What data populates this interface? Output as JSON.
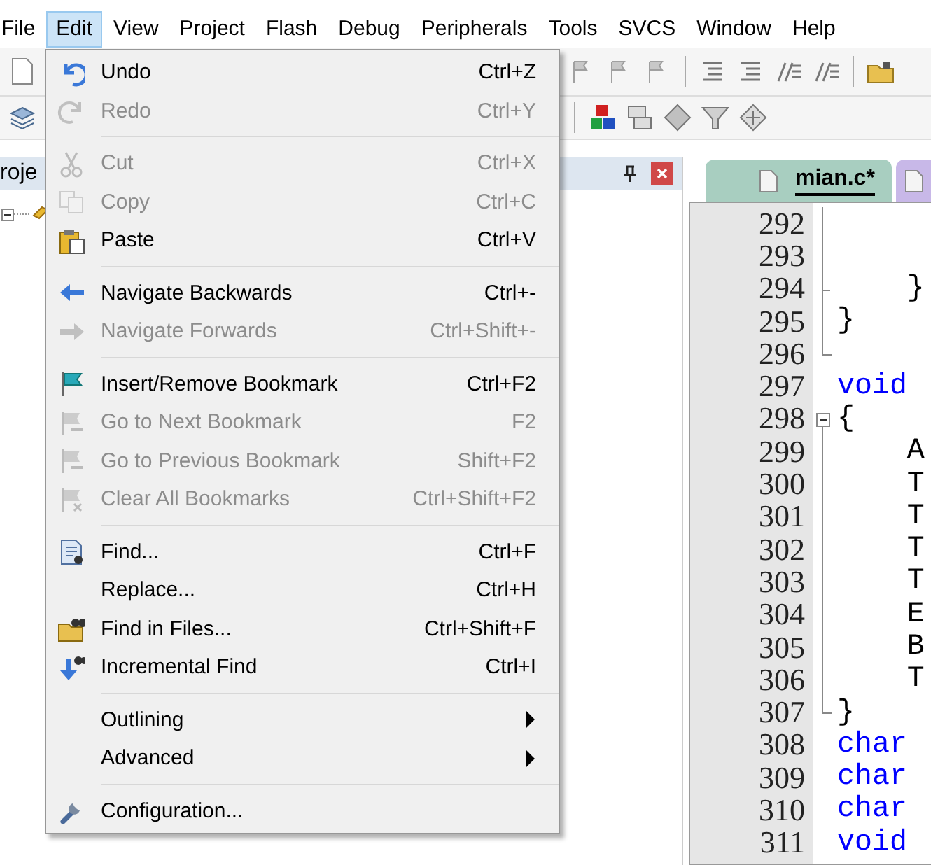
{
  "menubar": [
    {
      "label": "File",
      "selected": false
    },
    {
      "label": "Edit",
      "selected": true
    },
    {
      "label": "View",
      "selected": false
    },
    {
      "label": "Project",
      "selected": false
    },
    {
      "label": "Flash",
      "selected": false
    },
    {
      "label": "Debug",
      "selected": false
    },
    {
      "label": "Peripherals",
      "selected": false
    },
    {
      "label": "Tools",
      "selected": false
    },
    {
      "label": "SVCS",
      "selected": false
    },
    {
      "label": "Window",
      "selected": false
    },
    {
      "label": "Help",
      "selected": false
    }
  ],
  "project_panel": {
    "title": "roje"
  },
  "editor": {
    "tabs": [
      {
        "label": "mian.c*",
        "selected": true
      },
      {
        "selected": false
      }
    ],
    "lines": [
      {
        "number": "292",
        "fold_guide": true,
        "fold_box": false,
        "fold_end": false
      },
      {
        "number": "293",
        "fold_guide": true,
        "fold_box": false,
        "fold_end": false
      },
      {
        "number": "294",
        "code": "    }",
        "fold_guide": true,
        "fold_box": false,
        "fold_end": true
      },
      {
        "number": "295",
        "code": "}",
        "fold_guide": true,
        "fold_box": false,
        "fold_end": false
      },
      {
        "number": "296",
        "fold_guide": false,
        "fold_box": false,
        "fold_end": true
      },
      {
        "number": "297",
        "code": "void",
        "kind": "keyword",
        "fold_guide": false,
        "fold_box": false,
        "fold_end": false
      },
      {
        "number": "298",
        "code": "{",
        "fold_guide": false,
        "fold_box": true,
        "fold_end": false
      },
      {
        "number": "299",
        "code": "    A",
        "fold_guide": true,
        "fold_box": false,
        "fold_end": false
      },
      {
        "number": "300",
        "code": "    T",
        "fold_guide": true,
        "fold_box": false,
        "fold_end": false
      },
      {
        "number": "301",
        "code": "    T",
        "fold_guide": true,
        "fold_box": false,
        "fold_end": false
      },
      {
        "number": "302",
        "code": "    T",
        "fold_guide": true,
        "fold_box": false,
        "fold_end": false
      },
      {
        "number": "303",
        "code": "    T",
        "fold_guide": true,
        "fold_box": false,
        "fold_end": false
      },
      {
        "number": "304",
        "code": "    E",
        "fold_guide": true,
        "fold_box": false,
        "fold_end": false
      },
      {
        "number": "305",
        "code": "    B",
        "fold_guide": true,
        "fold_box": false,
        "fold_end": false
      },
      {
        "number": "306",
        "code": "    T",
        "fold_guide": true,
        "fold_box": false,
        "fold_end": false
      },
      {
        "number": "307",
        "code": "}",
        "fold_guide": false,
        "fold_box": false,
        "fold_end": true
      },
      {
        "number": "308",
        "code": "char",
        "kind": "keyword",
        "fold_guide": false,
        "fold_box": false,
        "fold_end": false
      },
      {
        "number": "309",
        "code": "char",
        "kind": "keyword",
        "fold_guide": false,
        "fold_box": false,
        "fold_end": false
      },
      {
        "number": "310",
        "code": "char",
        "kind": "keyword",
        "fold_guide": false,
        "fold_box": false,
        "fold_end": false
      },
      {
        "number": "311",
        "code": "void",
        "kind": "keyword",
        "fold_guide": false,
        "fold_box": false,
        "fold_end": false
      }
    ]
  },
  "edit_menu": [
    {
      "kind": "item",
      "label": "Undo",
      "shortcut": "Ctrl+Z",
      "disabled": false
    },
    {
      "kind": "item",
      "label": "Redo",
      "shortcut": "Ctrl+Y",
      "disabled": true
    },
    {
      "kind": "separator"
    },
    {
      "kind": "item",
      "label": "Cut",
      "shortcut": "Ctrl+X",
      "disabled": true
    },
    {
      "kind": "item",
      "label": "Copy",
      "shortcut": "Ctrl+C",
      "disabled": true
    },
    {
      "kind": "item",
      "label": "Paste",
      "shortcut": "Ctrl+V",
      "disabled": false
    },
    {
      "kind": "separator"
    },
    {
      "kind": "item",
      "label": "Navigate Backwards",
      "shortcut": "Ctrl+-",
      "disabled": false
    },
    {
      "kind": "item",
      "label": "Navigate Forwards",
      "shortcut": "Ctrl+Shift+-",
      "disabled": true
    },
    {
      "kind": "separator"
    },
    {
      "kind": "item",
      "label": "Insert/Remove Bookmark",
      "shortcut": "Ctrl+F2",
      "disabled": false
    },
    {
      "kind": "item",
      "label": "Go to Next Bookmark",
      "shortcut": "F2",
      "disabled": true
    },
    {
      "kind": "item",
      "label": "Go to Previous Bookmark",
      "shortcut": "Shift+F2",
      "disabled": true
    },
    {
      "kind": "item",
      "label": "Clear All Bookmarks",
      "shortcut": "Ctrl+Shift+F2",
      "disabled": true
    },
    {
      "kind": "separator"
    },
    {
      "kind": "item",
      "label": "Find...",
      "shortcut": "Ctrl+F",
      "disabled": false
    },
    {
      "kind": "item",
      "label": "Replace...",
      "shortcut": "Ctrl+H",
      "disabled": false
    },
    {
      "kind": "item",
      "label": "Find in Files...",
      "shortcut": "Ctrl+Shift+F",
      "disabled": false
    },
    {
      "kind": "item",
      "label": "Incremental Find",
      "shortcut": "Ctrl+I",
      "disabled": false
    },
    {
      "kind": "separator"
    },
    {
      "kind": "submenu",
      "label": "Outlining",
      "disabled": false
    },
    {
      "kind": "submenu",
      "label": "Advanced",
      "disabled": false
    },
    {
      "kind": "separator"
    },
    {
      "kind": "item",
      "label": "Configuration...",
      "disabled": false
    }
  ]
}
